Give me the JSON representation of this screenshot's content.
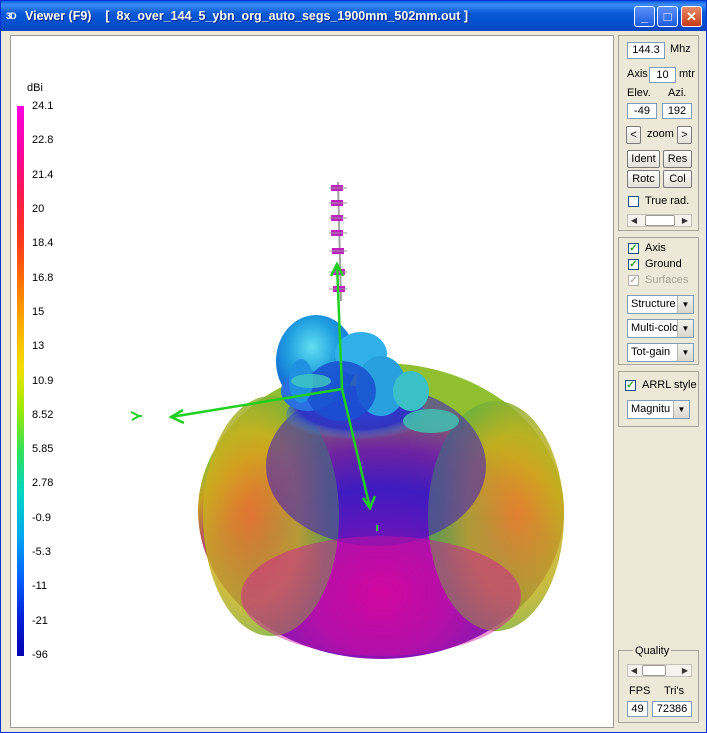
{
  "window": {
    "icon": "3D",
    "title": "Viewer (F9)    [  8x_over_144_5_ybn_org_auto_segs_1900mm_502mm.out ]",
    "minimize_icon": "minimize-icon",
    "maximize_icon": "maximize-icon",
    "close_icon": "close-icon"
  },
  "scale": {
    "unit": "dBi",
    "ticks": [
      "24.1",
      "22.8",
      "21.4",
      "20",
      "18.4",
      "16.8",
      "15",
      "13",
      "10.9",
      "8.52",
      "5.85",
      "2.78",
      "-0.9",
      "-5.3",
      "-11",
      "-21",
      "-96"
    ]
  },
  "panel": {
    "freq_value": "144.3",
    "freq_unit": "Mhz",
    "axis_label": "Axis",
    "axis_value": "10",
    "axis_unit": "mtr",
    "elev_label": "Elev.",
    "azi_label": "Azi.",
    "elev_value": "-49",
    "azi_value": "192",
    "zoom_left": "<",
    "zoom_label": "zoom",
    "zoom_right": ">",
    "ident_label": "Ident",
    "res_label": "Res",
    "rotc_label": "Rotc",
    "col_label": "Col",
    "true_rad_label": "True rad.",
    "axis_check_label": "Axis",
    "ground_check_label": "Ground",
    "surfaces_check_label": "Surfaces",
    "structure_select": "Structure",
    "multicolor_select": "Multi-colo",
    "totgain_select": "Tot-gain",
    "arrl_label": "ARRL style",
    "magnitude_select": "Magnitu",
    "quality_label": "Quality",
    "fps_label": "FPS",
    "tris_label": "Tri's",
    "fps_value": "49",
    "tris_value": "72386"
  },
  "state": {
    "true_rad": false,
    "axis": true,
    "ground": true,
    "surfaces": true,
    "arrl_style": true
  }
}
